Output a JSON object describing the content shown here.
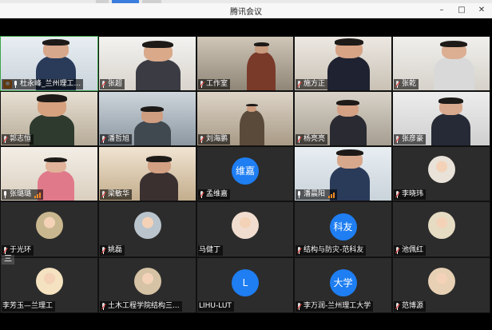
{
  "window": {
    "title": "腾讯会议",
    "controls": {
      "minimize": "–",
      "maximize": "□",
      "close": "✕"
    }
  },
  "participants": [
    {
      "name": "杜永峰_兰州理工...",
      "type": "video",
      "speaking": true,
      "host": true,
      "mic": "on"
    },
    {
      "name": "张超",
      "type": "video",
      "mic": "off"
    },
    {
      "name": "工作室",
      "type": "video",
      "mic": "off"
    },
    {
      "name": "施方正",
      "type": "video",
      "mic": "off"
    },
    {
      "name": "张乾",
      "type": "video",
      "mic": "off"
    },
    {
      "name": "郭志恒",
      "type": "video",
      "mic": "off"
    },
    {
      "name": "潘哲旭",
      "type": "video",
      "mic": "off"
    },
    {
      "name": "刘海鹏",
      "type": "video",
      "mic": "off"
    },
    {
      "name": "杨亮亮",
      "type": "video",
      "mic": "off"
    },
    {
      "name": "张彦豪",
      "type": "video",
      "mic": "off"
    },
    {
      "name": "张璐璐",
      "type": "video",
      "mic": "on",
      "signal": true
    },
    {
      "name": "梁敏华",
      "type": "video",
      "mic": "off"
    },
    {
      "name": "孟维嘉",
      "type": "avatar",
      "avatar_text": "维嘉",
      "mic": "off"
    },
    {
      "name": "潘晨阳",
      "type": "video",
      "mic": "on",
      "signal": true
    },
    {
      "name": "李晓玮",
      "type": "photo",
      "mic": "off"
    },
    {
      "name": "于光环",
      "type": "photo",
      "mic": "off"
    },
    {
      "name": "姚磊",
      "type": "photo",
      "mic": "off"
    },
    {
      "name": "马健丁",
      "type": "photo",
      "mic": "none"
    },
    {
      "name": "结构与防灾-范科友",
      "type": "avatar",
      "avatar_text": "科友",
      "mic": "off"
    },
    {
      "name": "池佩红",
      "type": "photo",
      "mic": "off"
    },
    {
      "name": "李芳玉—兰理工",
      "type": "photo",
      "mic": "none"
    },
    {
      "name": "土木工程学院结构三...",
      "type": "photo",
      "mic": "off"
    },
    {
      "name": "LIHU-LUT",
      "type": "avatar",
      "avatar_text": "L",
      "mic": "none"
    },
    {
      "name": "李万润-兰州理工大学",
      "type": "avatar",
      "avatar_text": "大学",
      "mic": "off"
    },
    {
      "name": "范博源",
      "type": "photo",
      "mic": "off"
    }
  ],
  "more_button": "三",
  "colors": {
    "accent": "#1e7ef2",
    "speaking_border": "#3ea34a",
    "host_badge": "#f08a24",
    "background": "#000000"
  }
}
